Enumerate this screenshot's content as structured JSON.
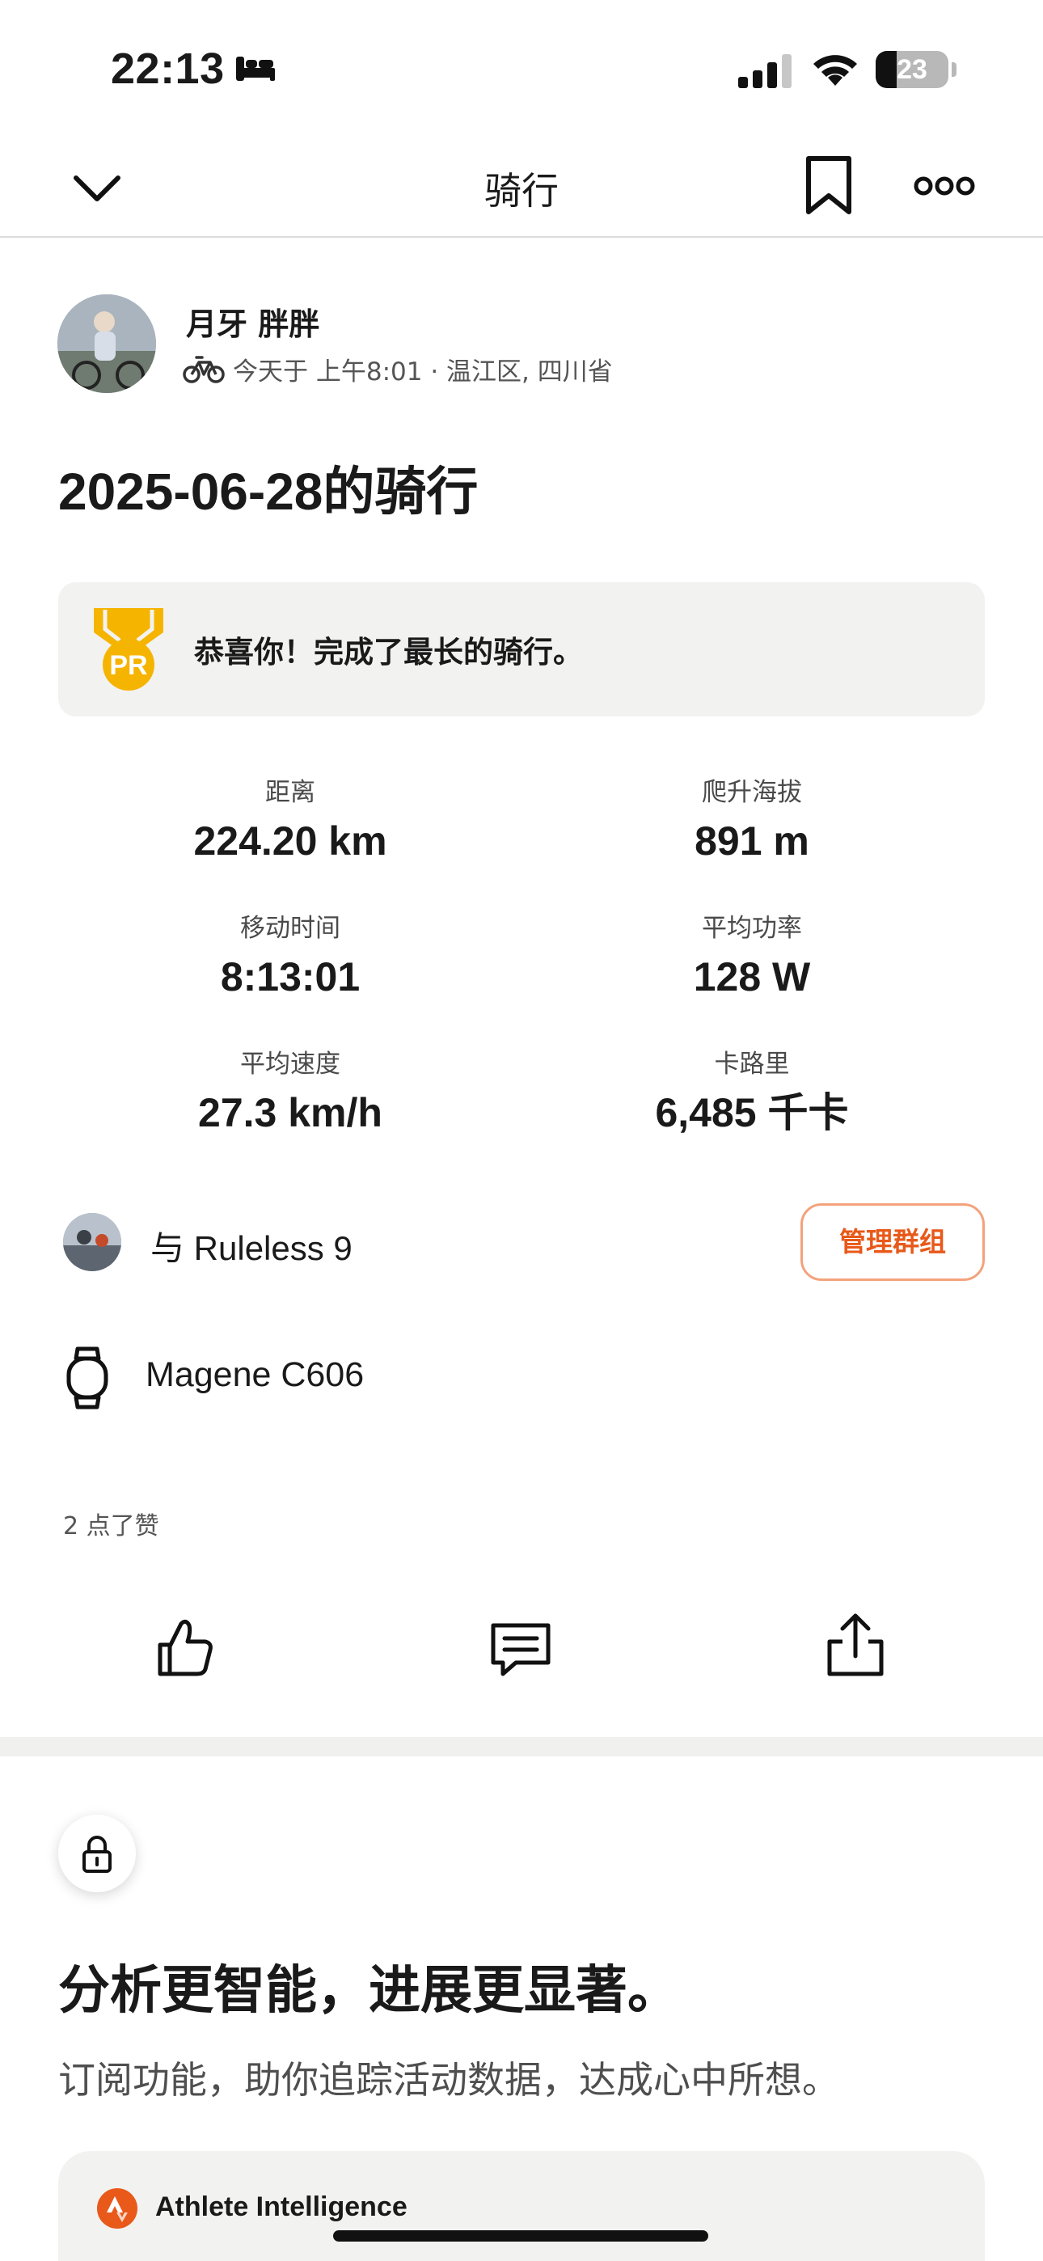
{
  "status_bar": {
    "time": "22:13",
    "battery_level": "23",
    "icons": [
      "sleep-focus-icon",
      "cellular-signal-icon",
      "wifi-icon",
      "battery-icon"
    ]
  },
  "nav": {
    "title": "骑行",
    "icons": [
      "chevron-down-icon",
      "bookmark-icon",
      "more-icon"
    ]
  },
  "athlete": {
    "name": "月牙 胖胖",
    "meta": "今天于 上午8:01 · 温江区, 四川省"
  },
  "activity": {
    "title": "2025-06-28的骑行"
  },
  "pr_banner": {
    "medal_text": "PR",
    "message": "恭喜你！完成了最长的骑行。"
  },
  "stats": [
    {
      "label": "距离",
      "value": "224.20 km"
    },
    {
      "label": "爬升海拔",
      "value": "891 m"
    },
    {
      "label": "移动时间",
      "value": "8:13:01"
    },
    {
      "label": "平均功率",
      "value": "128 W"
    },
    {
      "label": "平均速度",
      "value": "27.3 km/h"
    },
    {
      "label": "卡路里",
      "value": "6,485 千卡"
    }
  ],
  "group": {
    "label": "与 Ruleless 9",
    "manage_button": "管理群组"
  },
  "device": {
    "name": "Magene C606"
  },
  "kudos": {
    "count_text": "2 点了赞"
  },
  "actions": [
    "like-icon",
    "comment-icon",
    "share-icon"
  ],
  "promo": {
    "heading": "分析更智能，进展更显著。",
    "subtext": "订阅功能，助你追踪活动数据，达成心中所想。",
    "feature_card_title": "Athlete Intelligence"
  },
  "colors": {
    "accent": "#e8591a",
    "button_border": "#f4a27c",
    "medal": "#f5b400",
    "card_bg": "#f2f2f0"
  }
}
